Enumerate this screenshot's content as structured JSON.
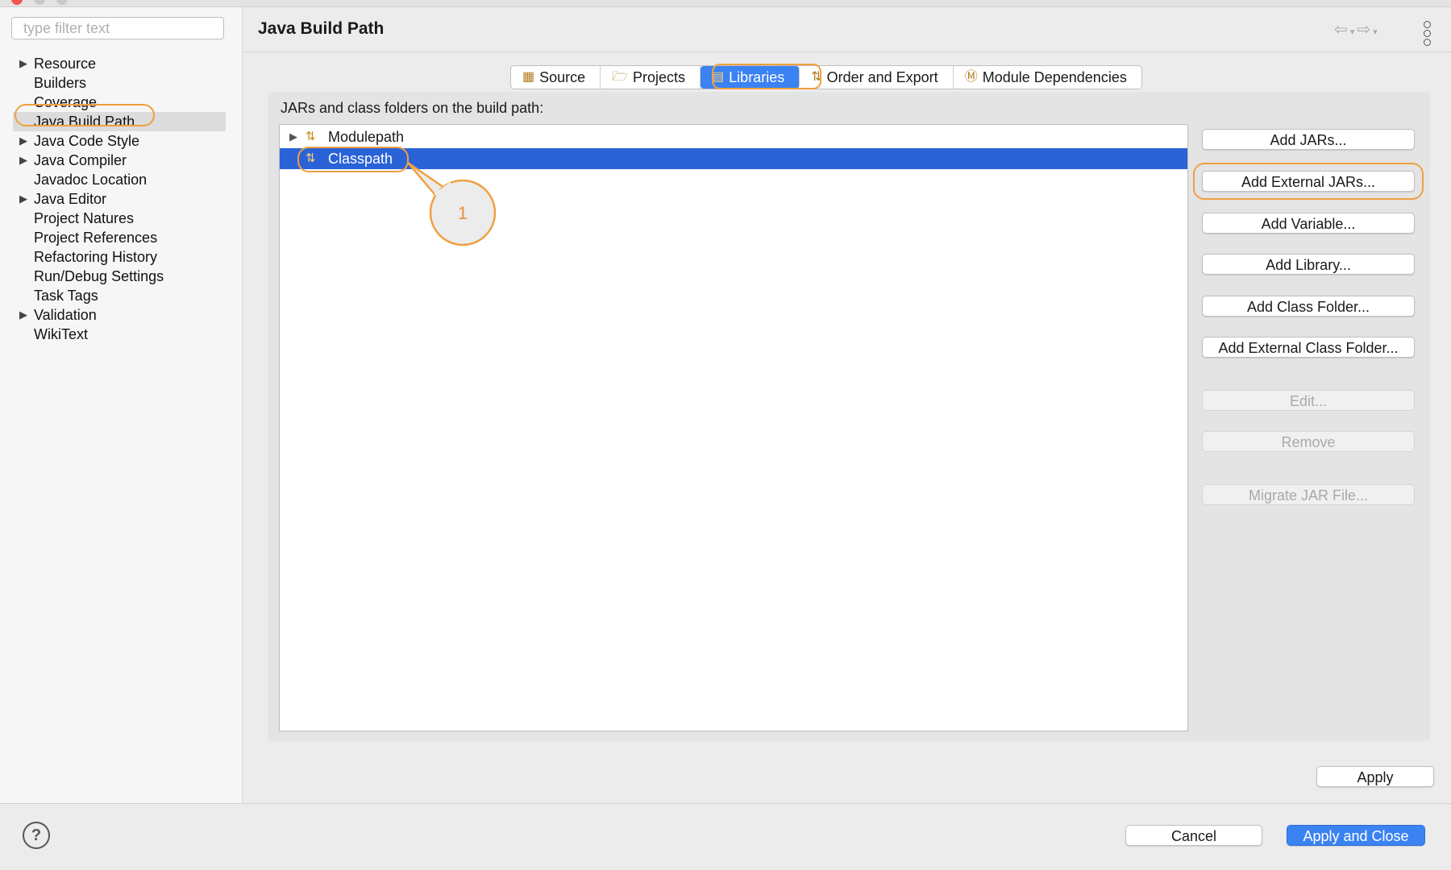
{
  "window": {
    "traffic_colors": [
      "#f2554a",
      "#f5bd2d",
      "#c9c9c9"
    ]
  },
  "sidebar": {
    "filter_placeholder": "type filter text",
    "items": [
      {
        "label": "Resource",
        "expandable": true
      },
      {
        "label": "Builders",
        "expandable": false
      },
      {
        "label": "Coverage",
        "expandable": false
      },
      {
        "label": "Java Build Path",
        "expandable": false,
        "selected": true
      },
      {
        "label": "Java Code Style",
        "expandable": true
      },
      {
        "label": "Java Compiler",
        "expandable": true
      },
      {
        "label": "Javadoc Location",
        "expandable": false
      },
      {
        "label": "Java Editor",
        "expandable": true
      },
      {
        "label": "Project Natures",
        "expandable": false
      },
      {
        "label": "Project References",
        "expandable": false
      },
      {
        "label": "Refactoring History",
        "expandable": false
      },
      {
        "label": "Run/Debug Settings",
        "expandable": false
      },
      {
        "label": "Task Tags",
        "expandable": false
      },
      {
        "label": "Validation",
        "expandable": true
      },
      {
        "label": "WikiText",
        "expandable": false
      }
    ]
  },
  "header": {
    "title": "Java Build Path"
  },
  "tabs": [
    {
      "label": "Source",
      "icon": "source-icon"
    },
    {
      "label": "Projects",
      "icon": "projects-folder-icon"
    },
    {
      "label": "Libraries",
      "icon": "libraries-icon",
      "active": true
    },
    {
      "label": "Order and Export",
      "icon": "order-export-icon"
    },
    {
      "label": "Module Dependencies",
      "icon": "module-icon"
    }
  ],
  "main": {
    "section_label": "JARs and class folders on the build path:",
    "entries": [
      {
        "label": "Modulepath",
        "expandable": true
      },
      {
        "label": "Classpath",
        "expandable": false,
        "selected": true
      }
    ],
    "buttons": {
      "add_jars": "Add JARs...",
      "add_external_jars": "Add External JARs...",
      "add_variable": "Add Variable...",
      "add_library": "Add Library...",
      "add_class_folder": "Add Class Folder...",
      "add_external_class_folder": "Add External Class Folder...",
      "edit": "Edit...",
      "remove": "Remove",
      "migrate": "Migrate JAR File..."
    },
    "apply": "Apply"
  },
  "annotation": {
    "callout_number": "1",
    "highlight_color": "#f0a040"
  },
  "footer": {
    "help": "?",
    "cancel": "Cancel",
    "apply_close": "Apply and Close"
  },
  "colors": {
    "accent": "#3b82f2",
    "selection": "#2a62d8"
  }
}
